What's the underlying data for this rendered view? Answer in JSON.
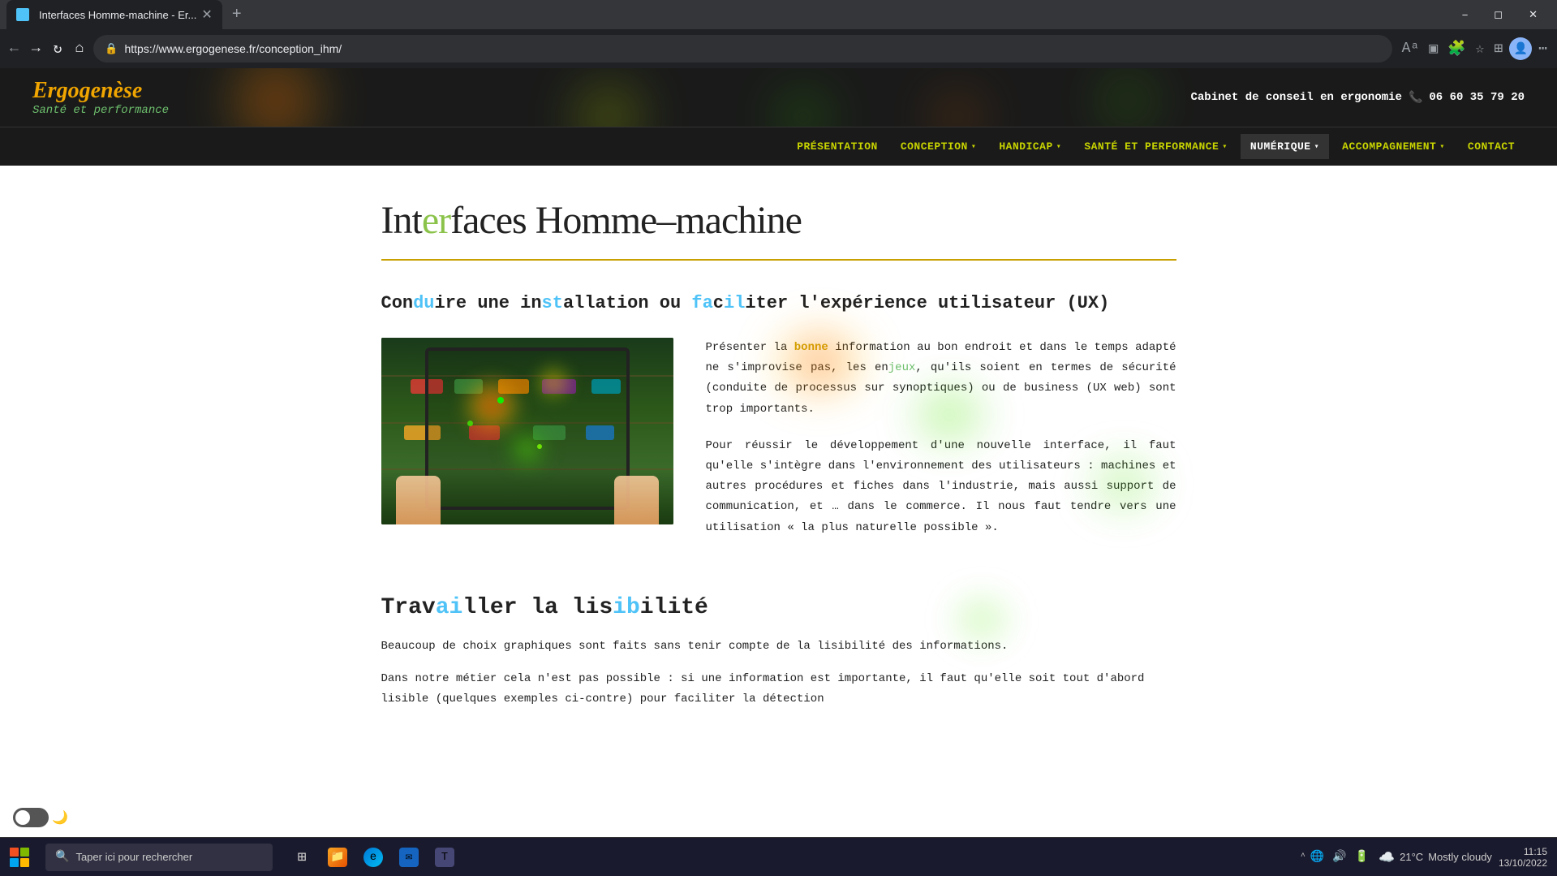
{
  "browser": {
    "tab_title": "Interfaces Homme-machine - Er...",
    "url": "https://www.ergogenese.fr/conception_ihm/",
    "favicon_color": "#4fc3f7"
  },
  "site": {
    "logo_main": "Ergogenèse",
    "logo_sub": "Santé et performance",
    "header_contact": "Cabinet de conseil en ergonomie",
    "phone": "06 60 35 79 20",
    "nav_items": [
      {
        "label": "PRÉSENTATION",
        "id": "presentation",
        "has_dropdown": false
      },
      {
        "label": "CONCEPTION",
        "id": "conception",
        "has_dropdown": true
      },
      {
        "label": "HANDICAP",
        "id": "handicap",
        "has_dropdown": true
      },
      {
        "label": "SANTÉ ET PERFORMANCE",
        "id": "sante",
        "has_dropdown": true
      },
      {
        "label": "NUMÉRIQUE",
        "id": "numerique",
        "has_dropdown": true,
        "active": true
      },
      {
        "label": "ACCOMPAGNEMENT",
        "id": "accompagnement",
        "has_dropdown": true
      },
      {
        "label": "CONTACT",
        "id": "contact",
        "has_dropdown": false
      }
    ]
  },
  "page": {
    "title": "Interfaces Homme–machine",
    "title_highlight": "er",
    "section1_heading": "Conduire une installation ou faciliter l'expérience utilisateur (UX)",
    "para1": "Présenter la bonne information au bon endroit et dans le temps adapté ne s'improvise pas, les enjeux, qu'ils soient en termes de sécurité (conduite de processus sur synoptiques) ou de business (UX web) sont trop importants.",
    "para2": "Pour réussir le développement d'une nouvelle interface, il faut qu'elle s'intègre dans l'environnement des utilisateurs : machines et autres procédures et fiches dans l'industrie, mais aussi support de communication, et … dans le commerce. Il nous faut tendre vers une utilisation « la plus naturelle possible ».",
    "section2_heading": "Travailler la lisibilité",
    "para3": "Beaucoup de choix graphiques sont faits sans tenir compte de la lisibilité des informations.",
    "para4": "Dans notre métier cela n'est pas possible : si une information est importante, il faut qu'elle soit tout d'abord lisible (quelques exemples ci-contre) pour faciliter la détection"
  },
  "taskbar": {
    "search_placeholder": "Taper ici pour rechercher",
    "weather_temp": "21°C",
    "weather_desc": "Mostly cloudy",
    "time": "11:15",
    "date": "13/10/2022"
  }
}
